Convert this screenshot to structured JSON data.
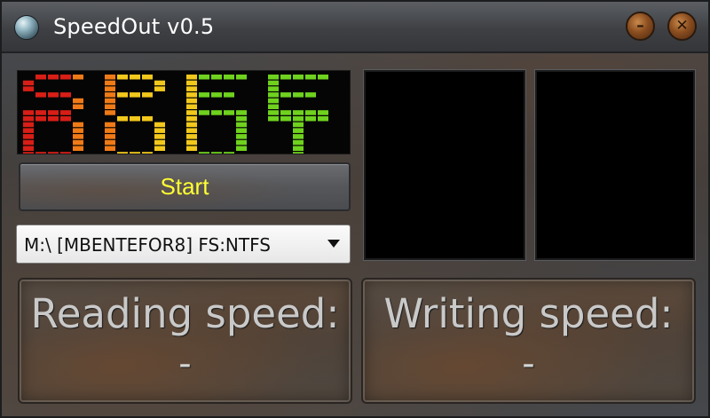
{
  "window": {
    "title": "SpeedOut v0.5"
  },
  "logo": {
    "text": "SPEEDOUT"
  },
  "controls": {
    "start_label": "Start",
    "drive_selected": "M:\\ [MBENTEFOR8] FS:NTFS"
  },
  "reading": {
    "label": "Reading speed:",
    "value": "-"
  },
  "writing": {
    "label": "Writing speed:",
    "value": "-"
  },
  "colors": {
    "logo_red": "#d81e16",
    "logo_orange": "#f07a16",
    "logo_yellow": "#f2c81c",
    "logo_green": "#6fd21e",
    "start_text": "#ffff33"
  }
}
